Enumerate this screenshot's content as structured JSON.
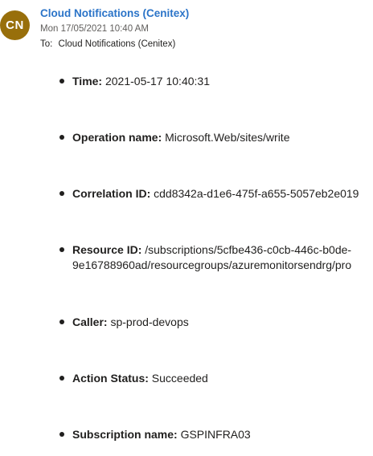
{
  "header": {
    "avatar_initials": "CN",
    "avatar_color": "#986f0b",
    "sender": "Cloud Notifications (Cenitex)",
    "date": "Mon 17/05/2021 10:40 AM",
    "to_label": "To:",
    "to_value": "Cloud Notifications (Cenitex)"
  },
  "items": [
    {
      "key": "Time:",
      "value": "2021-05-17 10:40:31"
    },
    {
      "key": "Operation name:",
      "value": "Microsoft.Web/sites/write"
    },
    {
      "key": "Correlation ID:",
      "value": "cdd8342a-d1e6-475f-a655-5057eb2e019"
    },
    {
      "key": "Resource ID:",
      "value": "/subscriptions/5cfbe436-c0cb-446c-b0de-",
      "value_line2": "9e16788960ad/resourcegroups/azuremonitorsendrg/pro"
    },
    {
      "key": "Caller:",
      "value": "sp-prod-devops"
    },
    {
      "key": "Action Status:",
      "value": "Succeeded"
    },
    {
      "key": "Subscription name:",
      "value": "GSPINFRA03"
    }
  ],
  "colors": {
    "link": "#2b74c8",
    "text": "#201f1e",
    "muted": "#605e5c"
  }
}
